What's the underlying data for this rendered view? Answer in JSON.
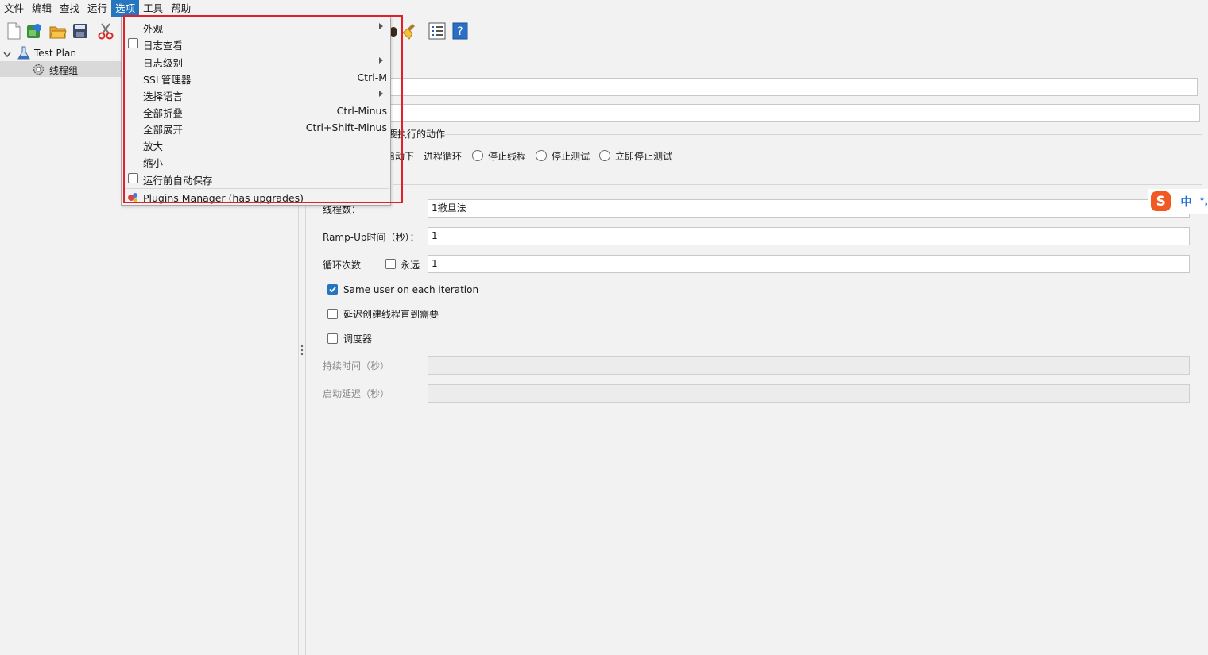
{
  "menubar": {
    "items": [
      "文件",
      "编辑",
      "查找",
      "运行",
      "选项",
      "工具",
      "帮助"
    ],
    "active_index": 4
  },
  "tree": {
    "root_label": "Test Plan",
    "child_label": "线程组"
  },
  "dropdown": {
    "items": [
      {
        "label": "外观",
        "accelerator": "",
        "submenu": true,
        "checkbox": false
      },
      {
        "label": "日志查看",
        "accelerator": "",
        "submenu": false,
        "checkbox": true
      },
      {
        "label": "日志级别",
        "accelerator": "",
        "submenu": true,
        "checkbox": false
      },
      {
        "label": "SSL管理器",
        "accelerator": "Ctrl-M",
        "submenu": false,
        "checkbox": false
      },
      {
        "label": "选择语言",
        "accelerator": "",
        "submenu": true,
        "checkbox": false
      },
      {
        "label": "全部折叠",
        "accelerator": "Ctrl-Minus",
        "submenu": false,
        "checkbox": false
      },
      {
        "label": "全部展开",
        "accelerator": "Ctrl+Shift-Minus",
        "submenu": false,
        "checkbox": false
      },
      {
        "label": "放大",
        "accelerator": "",
        "submenu": false,
        "checkbox": false
      },
      {
        "label": "缩小",
        "accelerator": "",
        "submenu": false,
        "checkbox": false
      },
      {
        "label": "运行前自动保存",
        "accelerator": "",
        "submenu": false,
        "checkbox": true
      },
      {
        "label": "Plugins Manager (has upgrades)",
        "accelerator": "",
        "submenu": false,
        "checkbox": false
      }
    ]
  },
  "form": {
    "action_title_partial": "要执行的动作",
    "radio_next_loop_partial": "启动下一进程循环",
    "radio_stop_thread": "停止线程",
    "radio_stop_test": "停止测试",
    "radio_stop_now": "立即停止测试",
    "threads_label": "线程数：",
    "threads_value": "1撤旦法",
    "rampup_label": "Ramp-Up时间（秒）：",
    "rampup_value": "1",
    "loop_label": "循环次数",
    "forever_label": "永远",
    "loop_value": "1",
    "same_user_label": "Same user on each iteration",
    "same_user_checked": true,
    "delay_label": "延迟创建线程直到需要",
    "scheduler_label": "调度器",
    "duration_label": "持续时间（秒）",
    "startup_delay_label": "启动延迟（秒）"
  },
  "ime": {
    "logo": "S",
    "mode": "中",
    "punct": "°,"
  },
  "colors": {
    "accent": "#2675bf",
    "highlight_box": "#e0202a"
  }
}
